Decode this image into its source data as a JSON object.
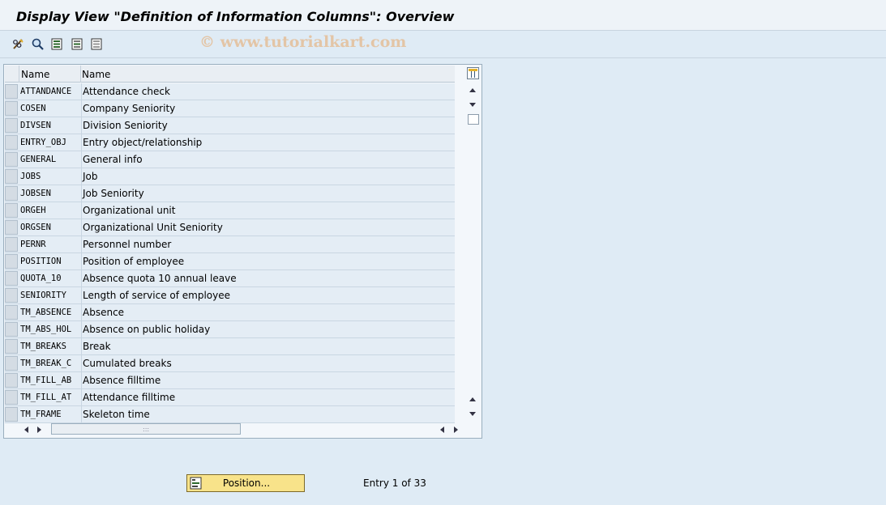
{
  "window": {
    "title": "Display View \"Definition of Information Columns\": Overview"
  },
  "toolbar": {
    "buttons": [
      {
        "icon": "display-change-icon"
      },
      {
        "icon": "find-icon"
      },
      {
        "icon": "select-all-icon"
      },
      {
        "icon": "select-block-icon"
      },
      {
        "icon": "deselect-all-icon"
      }
    ],
    "watermark": "© www.tutorialkart.com"
  },
  "table": {
    "columns": [
      "Name",
      "Name"
    ],
    "rows": [
      {
        "code": "ATTANDANCE",
        "desc": "Attendance check"
      },
      {
        "code": "COSEN",
        "desc": "Company Seniority"
      },
      {
        "code": "DIVSEN",
        "desc": "Division Seniority"
      },
      {
        "code": "ENTRY_OBJ",
        "desc": "Entry object/relationship"
      },
      {
        "code": "GENERAL",
        "desc": "General info"
      },
      {
        "code": "JOBS",
        "desc": "Job"
      },
      {
        "code": "JOBSEN",
        "desc": "Job Seniority"
      },
      {
        "code": "ORGEH",
        "desc": "Organizational unit"
      },
      {
        "code": "ORGSEN",
        "desc": "Organizational Unit Seniority"
      },
      {
        "code": "PERNR",
        "desc": "Personnel number"
      },
      {
        "code": "POSITION",
        "desc": "Position of employee"
      },
      {
        "code": "QUOTA_10",
        "desc": "Absence quota 10 annual leave"
      },
      {
        "code": "SENIORITY",
        "desc": "Length of service of employee"
      },
      {
        "code": "TM_ABSENCE",
        "desc": "Absence"
      },
      {
        "code": "TM_ABS_HOL",
        "desc": "Absence on public holiday"
      },
      {
        "code": "TM_BREAKS",
        "desc": "Break"
      },
      {
        "code": "TM_BREAK_C",
        "desc": "Cumulated breaks"
      },
      {
        "code": "TM_FILL_AB",
        "desc": "Absence filltime"
      },
      {
        "code": "TM_FILL_AT",
        "desc": "Attendance filltime"
      },
      {
        "code": "TM_FRAME",
        "desc": "Skeleton time"
      }
    ]
  },
  "footer": {
    "position_button": "Position...",
    "entry_info": "Entry 1 of 33"
  },
  "colors": {
    "background": "#dfebf5",
    "row": "#e4edf5",
    "button": "#f8e38a"
  }
}
